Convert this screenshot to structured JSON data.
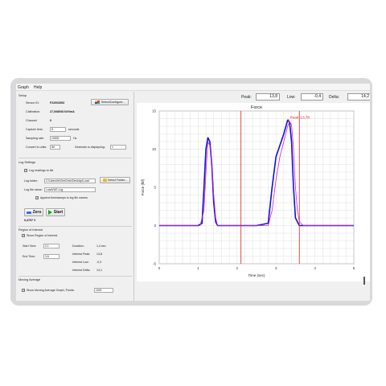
{
  "menu": {
    "graph": "Graph",
    "help": "Help"
  },
  "setup": {
    "title": "Setup",
    "sensor_id_label": "Sensor ID:",
    "sensor_id": "F22003393",
    "configure_button": "Select/Configure...",
    "calibration_label": "Calibration:",
    "calibration": "27,008008 N/V/mA",
    "channel_label": "Channel:",
    "channel": "0",
    "capture_time_label": "Capture time:",
    "capture_time": "5",
    "capture_time_unit": "seconds",
    "sampling_rate_label": "Sampling rate:",
    "sampling_rate": "10000",
    "sampling_rate_unit": "Hz",
    "convert_label": "Convert to units:",
    "convert_value": "lbf",
    "decimals_label": "Decimals to display/log:",
    "decimals_value": "1"
  },
  "log": {
    "title": "Log Settings",
    "log_readings": "Log readings to file",
    "folder_label": "Log folder:",
    "folder_value": "C:\\Users\\lb\\OneDrive\\Desktop\\Load",
    "select_folder": "Select Folder...",
    "file_label": "Log file name:",
    "file_value": "LoadVUE-Log",
    "append_timestamp": "Append timestamps to log file names"
  },
  "controls": {
    "zero": "Zero",
    "start": "Start",
    "voltage": "0,4757 V"
  },
  "roi": {
    "title": "Region of Interest",
    "show": "Show Region of Interest",
    "start_label": "Start Time:",
    "start_value": "2,1",
    "end_label": "End Time:",
    "end_value": "3,6",
    "duration_label": "Duration:",
    "duration_value": "1,4 sec",
    "peak_label": "Interest Peak:",
    "peak_value": "13,8",
    "low_label": "Interest Low:",
    "low_value": "-0,3",
    "delta_label": "Interest Delta:",
    "delta_value": "14,1"
  },
  "moving_avg": {
    "title": "Moving Average",
    "show": "Show Moving Average Graph, Points:",
    "points": "1001"
  },
  "readouts": {
    "peak_label": "Peak:",
    "peak": "13,8",
    "low_label": "Low:",
    "low": "-0,4",
    "delta_label": "Delta:",
    "delta": "14,2"
  },
  "colors": {
    "raw": "#1010e0",
    "avg": "#d020d0",
    "roi": "#e02020",
    "start_green": "#1aa31a",
    "zero_blue": "#3a6bd8"
  },
  "icons": {
    "configure": "palette-icon",
    "folder": "folder-icon",
    "zero": "zero-icon",
    "start": "play-icon"
  },
  "chart_data": {
    "type": "line",
    "title": "Force",
    "xlabel": "Time (sec)",
    "ylabel": "Force (lbf)",
    "xlim": [
      0,
      5
    ],
    "ylim": [
      -5,
      15
    ],
    "x_ticks": [
      0,
      1,
      2,
      3,
      4,
      5
    ],
    "y_ticks": [
      -5,
      0,
      5,
      10,
      15
    ],
    "grid": true,
    "roi_lines": [
      2.1,
      3.6
    ],
    "peak_marker": {
      "x": 3.32,
      "y": 13.8,
      "label": "Peak=13,78"
    },
    "series": [
      {
        "role": "raw",
        "x": [
          0,
          1.0,
          1.1,
          1.15,
          1.2,
          1.25,
          1.3,
          1.35,
          1.4,
          1.45,
          1.5,
          1.55,
          2.0,
          2.5,
          2.8,
          2.9,
          3.0,
          3.1,
          3.2,
          3.3,
          3.35,
          3.4,
          3.45,
          3.5,
          3.6,
          4.0,
          4.5,
          5.0
        ],
        "y": [
          0,
          0,
          0.3,
          5,
          10,
          11.5,
          11.0,
          8,
          3,
          0.5,
          0,
          0,
          0,
          0,
          0.3,
          5,
          9,
          10.5,
          12,
          13.8,
          13.5,
          11,
          5,
          1,
          0,
          0,
          0,
          0
        ]
      },
      {
        "role": "avg",
        "x": [
          0,
          1.05,
          1.15,
          1.2,
          1.25,
          1.3,
          1.35,
          1.4,
          1.45,
          1.5,
          1.6,
          2.8,
          2.9,
          3.0,
          3.1,
          3.2,
          3.3,
          3.35,
          3.4,
          3.45,
          3.5,
          3.55,
          3.6,
          3.7,
          5.0
        ],
        "y": [
          0,
          0,
          2,
          7,
          11,
          10.5,
          8,
          4,
          1,
          0,
          0,
          0,
          2,
          6,
          9,
          11,
          13,
          13.6,
          13.2,
          10,
          5,
          2,
          0.5,
          0,
          0
        ]
      }
    ]
  }
}
